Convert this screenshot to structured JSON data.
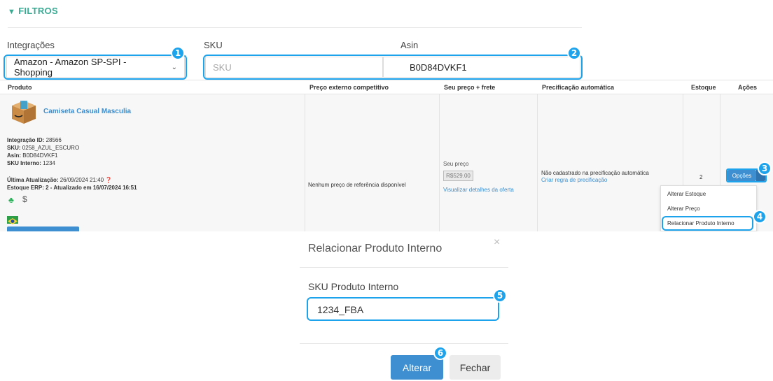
{
  "filters": {
    "title": "FILTROS",
    "icon": "funnel-icon",
    "integrations_label": "Integrações",
    "integrations_value": "Amazon - Amazon SP-SPI - Shopping",
    "sku_label": "SKU",
    "sku_placeholder": "SKU",
    "asin_label": "Asin",
    "asin_value": "B0D84DVKF1"
  },
  "table": {
    "headers": [
      "Produto",
      "Preço externo competitivo",
      "Seu preço + frete",
      "Precificação automática",
      "Estoque",
      "Ações"
    ],
    "row": {
      "product_name": "Camiseta Casual Masculia",
      "integration_id_label": "Integração ID:",
      "integration_id": "28566",
      "sku_label": "SKU:",
      "sku": "0258_AZUL_ESCURO",
      "asin_label": "Asin:",
      "asin": "B0D84DVKF1",
      "sku_interno_label": "SKU Interno:",
      "sku_interno": "1234",
      "last_update_label": "Última Atualização:",
      "last_update": "26/09/2024 21:40",
      "erp_stock": "Estoque ERP: 2 - Atualizado em 16/07/2024 16:51",
      "dollar": "$",
      "competitive_price": "Nenhum preço de referência disponível",
      "seu_preco_label": "Seu preço",
      "seu_preco_value": "R$529.00",
      "offer_link": "Visualizar detalhes da oferta",
      "auto_pricing_text": "Não cadastrado na precificação automática",
      "auto_pricing_link": "Criar regra de precificação",
      "stock": "2",
      "options_button": "Opções"
    }
  },
  "options_menu": [
    "Alterar Estoque",
    "Alterar Preço",
    "Relacionar Produto Interno"
  ],
  "modal": {
    "title": "Relacionar Produto Interno",
    "close": "×",
    "field_label": "SKU Produto Interno",
    "field_value": "1234_FBA",
    "primary_button": "Alterar",
    "secondary_button": "Fechar"
  },
  "badges": [
    "1",
    "2",
    "3",
    "4",
    "5",
    "6"
  ],
  "colors": {
    "accent": "#1ca3ec",
    "brand_green": "#3aab93",
    "primary_button": "#3d8fd1",
    "link": "#3b8fd0"
  }
}
